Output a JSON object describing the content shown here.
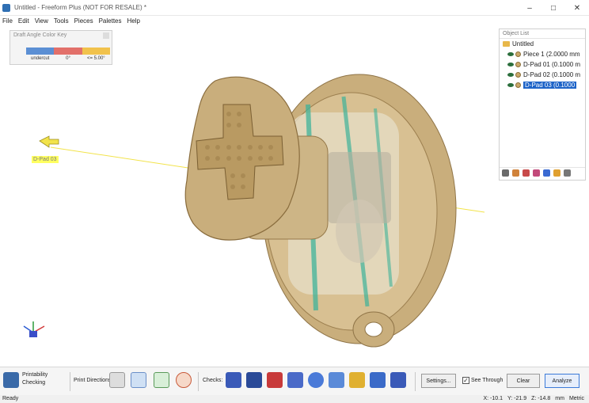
{
  "window": {
    "title": "Untitled - Freeform Plus (NOT FOR RESALE) *",
    "controls": [
      "minimize",
      "maximize",
      "close"
    ]
  },
  "menu": [
    "File",
    "Edit",
    "View",
    "Tools",
    "Pieces",
    "Palettes",
    "Help"
  ],
  "color_key": {
    "title": "Draft Angle Color Key",
    "colors": [
      "#5b8fd4",
      "#e2706a",
      "#f1c24c"
    ],
    "labels": [
      "undercut",
      "0°",
      "<= 5.00°"
    ]
  },
  "object_list": {
    "title": "Object List",
    "root": "Untitled",
    "items": [
      {
        "label": "Piece 1 (2.0000 mm",
        "selected": false
      },
      {
        "label": "D-Pad 01 (0.1000 m",
        "selected": false
      },
      {
        "label": "D-Pad 02 (0.1000 m",
        "selected": false
      },
      {
        "label": "D-Pad 03 (0.1000",
        "selected": true
      }
    ]
  },
  "viewport": {
    "direction_label": "D-Pad 03"
  },
  "toolbar": {
    "panel_label_line1": "Printability",
    "panel_label_line2": "Checking",
    "print_directions_label": "Print Directions",
    "checks_label": "Checks:",
    "settings_label": "Settings...",
    "see_through_label": "See Through",
    "see_through_checked": "✓",
    "clear_label": "Clear",
    "analyze_label": "Analyze"
  },
  "status": {
    "text": "Ready",
    "x": "X: -10.1",
    "y": "Y: -21.9",
    "z": "Z: -14.8",
    "unit": "mm",
    "unit_label": "Metric"
  },
  "colors": {
    "model": "#c9ae7c",
    "model_dark": "#8f7447",
    "highlight_green": "#3fb39a",
    "selection_blue": "#1e64c8",
    "direction_line": "#f2e34a"
  }
}
